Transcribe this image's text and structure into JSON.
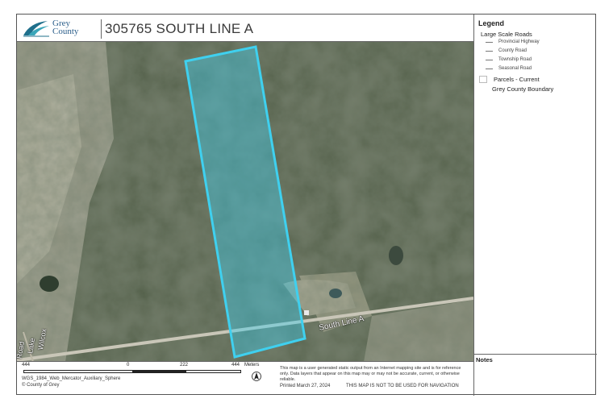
{
  "header": {
    "logo_text_line1": "Grey",
    "logo_text_line2": "County",
    "title": "305765 SOUTH LINE A"
  },
  "legend": {
    "title": "Legend",
    "roads_heading": "Large Scale Roads",
    "road_items": [
      "Provincial Highway",
      "County Road",
      "Township Road",
      "Seasonal Road"
    ],
    "parcels_label": "Parcels - Current",
    "boundary_label": "Grey County Boundary"
  },
  "notes": {
    "title": "Notes"
  },
  "map": {
    "road_label_south_line": "South Line A",
    "road_label_wilcox_1": "Wilcox",
    "road_label_wilcox_2": "Lake",
    "road_label_wilcox_3": "Road",
    "parcel_color": "#3fd0ef"
  },
  "footer": {
    "scale_left": "444",
    "scale_zero": "0",
    "scale_mid": "222",
    "scale_right": "444",
    "scale_unit": "Meters",
    "projection": "WGS_1984_Web_Mercator_Auxiliary_Sphere",
    "copyright": "© County of Grey",
    "disclaimer": "This map is a user generated static output from an Internet mapping site and is for reference only. Data layers that appear on this map may or may not be accurate, current, or otherwise reliable.",
    "printed": "Printed March 27, 2024",
    "nav_note": "THIS MAP IS NOT TO BE USED FOR NAVIGATION"
  }
}
